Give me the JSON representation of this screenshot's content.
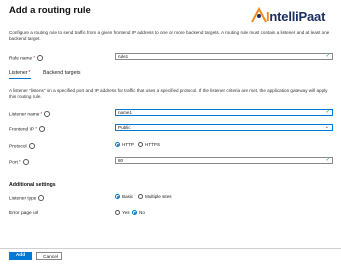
{
  "header": {
    "title": "Add a routing rule",
    "brand": {
      "prefix": "I",
      "rest": "ntelliPaat"
    }
  },
  "intro_text": "Configure a routing rule to send traffic from a given frontend IP address to one or more backend targets. A routing rule must contain a listener and at least one backend target.",
  "rule_name": {
    "label": "Rule name",
    "value": "rule1"
  },
  "tabs": [
    {
      "label": "Listener",
      "required": true,
      "active": true
    },
    {
      "label": "Backend targets",
      "required": false,
      "active": false
    }
  ],
  "listener_desc": "A listener \"listens\" on a specified port and IP address for traffic that uses a specified protocol. If the listener criteria are met, the application gateway will apply this routing rule.",
  "listener_name": {
    "label": "Listener name",
    "value": "name1"
  },
  "frontend_ip": {
    "label": "Frontend IP",
    "value": "Public"
  },
  "protocol": {
    "label": "Protocol",
    "options": [
      "HTTP",
      "HTTPS"
    ],
    "selected": "HTTP"
  },
  "port": {
    "label": "Port",
    "value": "80"
  },
  "additional": {
    "title": "Additional settings",
    "listener_type": {
      "label": "Listener type",
      "options": [
        "Basic",
        "Multiple sites"
      ],
      "selected": "Basic"
    },
    "error_page": {
      "label": "Error page url",
      "options": [
        "Yes",
        "No"
      ],
      "selected": "No"
    }
  },
  "footer": {
    "add_label": "Add",
    "cancel_label": "Cancel"
  },
  "colors": {
    "accent": "#0078d4",
    "brand_dark": "#1c2f63",
    "brand_orange": "#f28b1e",
    "required": "#a4262c",
    "valid": "#107c10"
  }
}
